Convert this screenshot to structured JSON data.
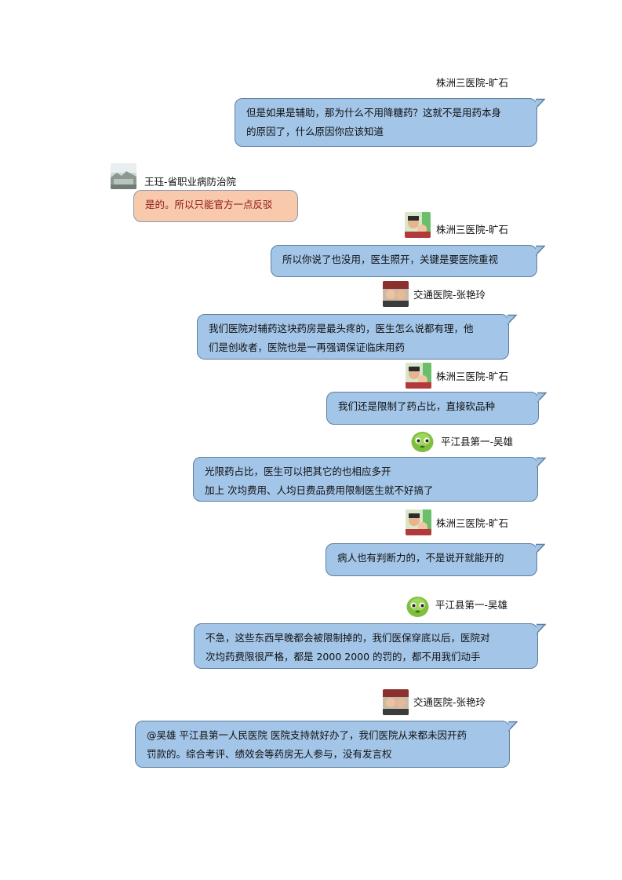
{
  "messages": [
    {
      "sender": "株洲三医院-旷石",
      "lines": [
        "但是如果是辅助，那为什么不用降糖药？这就不是用药本身",
        "的原因了，什么原因你应该知道"
      ]
    },
    {
      "sender": "王珏-省职业病防治院",
      "lines": [
        "是的。所以只能官方一点反驳"
      ]
    },
    {
      "sender": "株洲三医院-旷石",
      "lines": [
        "所以你说了也没用，医生照开，关键是要医院重视"
      ]
    },
    {
      "sender": "交通医院-张艳玲",
      "lines": [
        "我们医院对辅药这块药房是最头疼的，医生怎么说都有理，他",
        "们是创收者，医院也是一再强调保证临床用药"
      ]
    },
    {
      "sender": "株洲三医院-旷石",
      "lines": [
        "我们还是限制了药占比，直接砍品种"
      ]
    },
    {
      "sender": "平江县第一-吴雄",
      "lines": [
        "光限药占比，医生可以把其它的也相应多开",
        "加上 次均费用、人均日费品费用限制医生就不好搞了"
      ]
    },
    {
      "sender": "株洲三医院-旷石",
      "lines": [
        "病人也有判断力的，不是说开就能开的"
      ]
    },
    {
      "sender": "平江县第一-吴雄",
      "lines": [
        "不急，这些东西早晚都会被限制掉的，我们医保穿底以后，医院对",
        "次均药费限很严格，都是  2000 2000 的罚的，都不用我们动手"
      ]
    },
    {
      "sender": "交通医院-张艳玲",
      "lines": [
        "@吴雄 平江县第一人民医院 医院支持就好办了，我们医院从来都未因开药",
        "罚款的。综合考评、绩效会等药房无人参与，没有发言权"
      ]
    }
  ]
}
